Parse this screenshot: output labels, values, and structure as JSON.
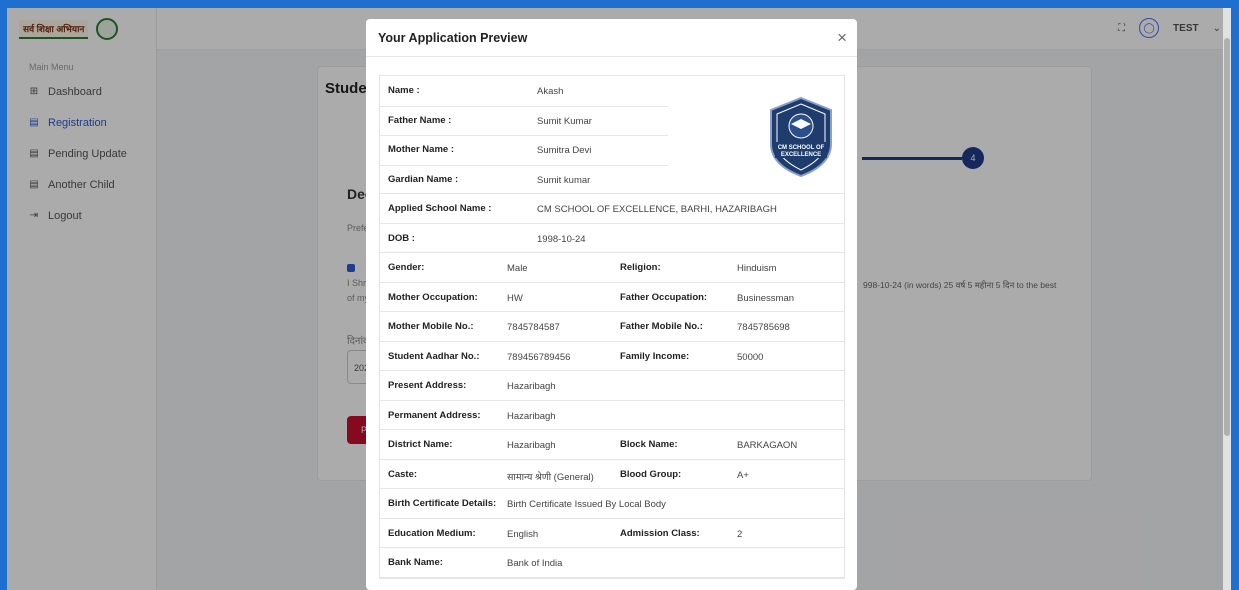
{
  "sidebar": {
    "logo_text": "सर्व शिक्षा अभियान",
    "menu_title": "Main Menu",
    "items": [
      {
        "label": "Dashboard",
        "icon": "grid-icon"
      },
      {
        "label": "Registration",
        "icon": "form-icon"
      },
      {
        "label": "Pending Update",
        "icon": "form-icon"
      },
      {
        "label": "Another Child",
        "icon": "form-icon"
      },
      {
        "label": "Logout",
        "icon": "logout-icon"
      }
    ]
  },
  "topbar": {
    "user": "TEST"
  },
  "background_page": {
    "title": "Studer",
    "section_title": "Decla",
    "preference_text": "Prefer",
    "declaration_left": "I Shri/S",
    "declaration_left2": "of my k",
    "declaration_tail": "998-10-24 (in words) 25 वर्ष 5 महीना 5 दिन to the best",
    "date_label": "दिनांक",
    "date_value": "2024",
    "button_label": "Pr",
    "step_number": "4"
  },
  "modal": {
    "title": "Your Application Preview",
    "close": "×",
    "school_logo_text": "CM SCHOOL OF EXCELLENCE",
    "fields": {
      "name": {
        "label": "Name :",
        "value": "Akash"
      },
      "father": {
        "label": "Father Name :",
        "value": "Sumit Kumar"
      },
      "mother": {
        "label": "Mother Name :",
        "value": "Sumitra Devi"
      },
      "guardian": {
        "label": "Gardian Name :",
        "value": "Sumit kumar"
      },
      "school": {
        "label": "Applied School Name :",
        "value": "CM SCHOOL OF EXCELLENCE, BARHI, HAZARIBAGH"
      },
      "dob": {
        "label": "DOB :",
        "value": "1998-10-24"
      }
    },
    "grid": [
      {
        "l1": "Gender:",
        "v1": "Male",
        "l2": "Religion:",
        "v2": "Hinduism"
      },
      {
        "l1": "Mother Occupation:",
        "v1": "HW",
        "l2": "Father Occupation:",
        "v2": "Businessman"
      },
      {
        "l1": "Mother Mobile No.:",
        "v1": "7845784587",
        "l2": "Father Mobile No.:",
        "v2": "7845785698"
      },
      {
        "l1": "Student Aadhar No.:",
        "v1": "789456789456",
        "l2": "Family Income:",
        "v2": "50000"
      },
      {
        "l1": "Present Address:",
        "v1": "Hazaribagh",
        "l2": "",
        "v2": ""
      },
      {
        "l1": "Permanent Address:",
        "v1": "Hazaribagh",
        "l2": "",
        "v2": ""
      },
      {
        "l1": "District Name:",
        "v1": "Hazaribagh",
        "l2": "Block Name:",
        "v2": "BARKAGAON"
      },
      {
        "l1": "Caste:",
        "v1": "सामान्य श्रेणी (General)",
        "l2": "Blood Group:",
        "v2": "A+"
      },
      {
        "l1": "Birth Certificate Details:",
        "v1": "Birth Certificate Issued By Local Body",
        "l2": "",
        "v2": ""
      },
      {
        "l1": "Education Medium:",
        "v1": "English",
        "l2": "Admission Class:",
        "v2": "2"
      },
      {
        "l1": "Bank Name:",
        "v1": "Bank of India",
        "l2": "",
        "v2": ""
      }
    ]
  },
  "colors": {
    "accent": "#2a5bd7",
    "step": "#1f3c8a",
    "danger": "#c8102e",
    "frame": "#1e6fd0"
  }
}
